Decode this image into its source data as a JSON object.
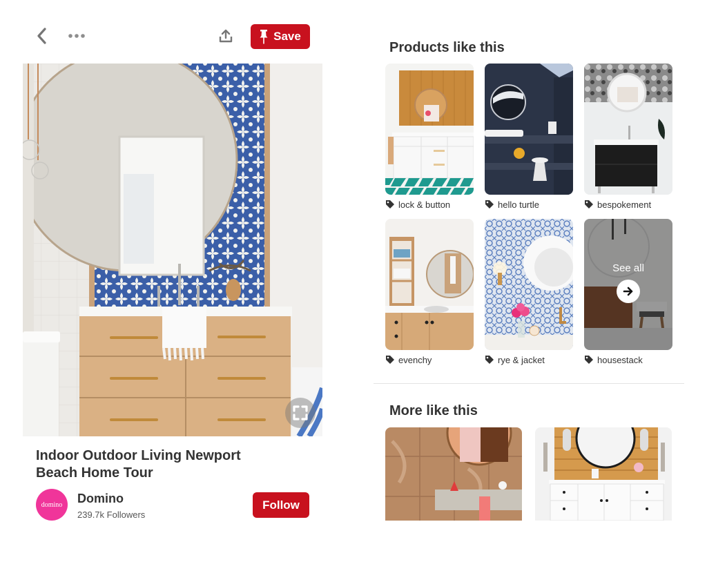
{
  "toolbar": {
    "back_icon": "chevron-left-icon",
    "more_icon": "ellipsis-icon",
    "share_icon": "share-upload-icon",
    "save_icon": "pushpin-icon",
    "save_label": "Save"
  },
  "pin": {
    "image_description": "Bathroom with large round mirror, blue patterned tile backsplash and light wood vanity with brass pulls",
    "expand_icon": "expand-fullscreen-icon",
    "title": "Indoor Outdoor Living Newport Beach Home Tour",
    "creator": {
      "avatar_text": "domino",
      "name": "Domino",
      "followers": "239.7k Followers",
      "follow_label": "Follow"
    }
  },
  "products": {
    "title": "Products like this",
    "items": [
      {
        "label": "lock & button",
        "icon": "tag-icon",
        "image": "wood-panel bathroom with teal tile floor"
      },
      {
        "label": "hello turtle",
        "icon": "tag-icon",
        "image": "dark tiled bathroom with round mirror"
      },
      {
        "label": "bespokement",
        "icon": "tag-icon",
        "image": "black vanity with round mirror and floral wallpaper"
      },
      {
        "label": "evenchy",
        "icon": "tag-icon",
        "image": "wood shelving bathroom with round mirror"
      },
      {
        "label": "rye & jacket",
        "icon": "tag-icon",
        "image": "blue tile wall with white round mirror and pink flowers"
      },
      {
        "label": "housestack",
        "icon": "tag-icon",
        "image": "dark bathroom with wooden vanity",
        "overlay": {
          "text": "See all",
          "icon": "arrow-right-icon"
        }
      }
    ]
  },
  "more": {
    "title": "More like this",
    "items": [
      {
        "image": "wood-grain tiled bathroom with concrete sink and round mirror"
      },
      {
        "image": "white double vanity with wood plank wall and round black mirror"
      }
    ]
  },
  "colors": {
    "brand_red": "#c8111e",
    "avatar_pink": "#f0359a",
    "text_primary": "#333333"
  }
}
